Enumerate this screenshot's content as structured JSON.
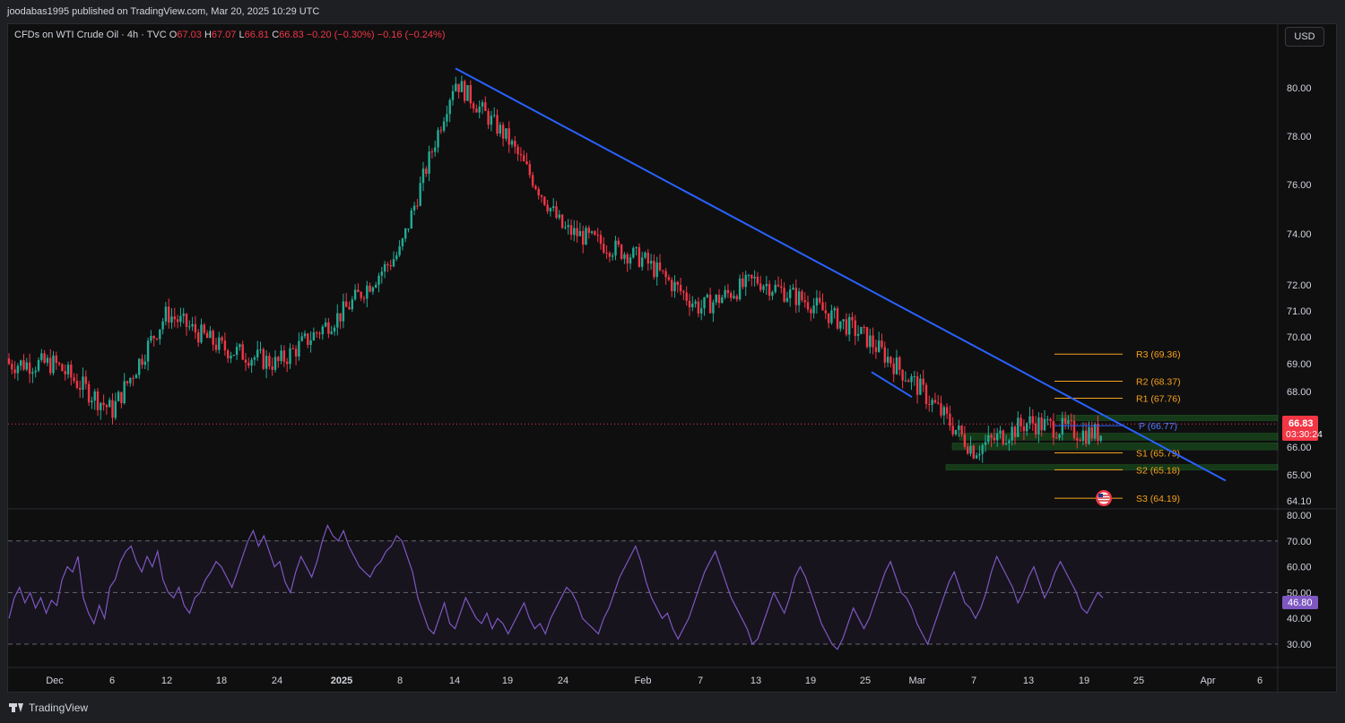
{
  "header": {
    "published": "joodabas1995 published on TradingView.com, Mar 20, 2025 10:29 UTC"
  },
  "legend": {
    "symbol": "CFDs on WTI Crude Oil · 4h · TVC",
    "o_label": "O",
    "o": "67.03",
    "h_label": "H",
    "h": "67.07",
    "l_label": "L",
    "l": "66.81",
    "c_label": "C",
    "c": "66.83",
    "change": "−0.20 (−0.30%)",
    "change2": "−0.16 (−0.24%)"
  },
  "toolbar": {
    "currency": "USD"
  },
  "footer": {
    "brand": "TradingView"
  },
  "colors": {
    "up": "#22ab94",
    "down": "#f23645",
    "trendline": "#2962ff",
    "pivot_level": "#f7a21b",
    "pivot_line": "#2962ff",
    "zone": "#1b5e20",
    "rsi": "#7e57c2",
    "rsi_band": "#7e57c2"
  },
  "chart_data": [
    {
      "type": "candlestick",
      "title": "",
      "ylabel": "",
      "ylim": [
        63.7,
        80.8
      ],
      "x_ticks": [
        "Dec",
        "6",
        "12",
        "18",
        "24",
        "2025",
        "8",
        "14",
        "19",
        "24",
        "Feb",
        "7",
        "13",
        "19",
        "25",
        "Mar",
        "7",
        "13",
        "19",
        "25",
        "Apr",
        "6"
      ],
      "y_ticks": [
        "80.00",
        "78.00",
        "76.00",
        "74.00",
        "72.00",
        "71.00",
        "70.00",
        "69.00",
        "68.00",
        "66.00",
        "65.00",
        "64.10"
      ],
      "current_price": "66.83",
      "countdown": "03:30:24",
      "close_path": [
        [
          "Dec",
          69.0
        ],
        [
          "6",
          67.3
        ],
        [
          "12",
          70.9
        ],
        [
          "18",
          69.6
        ],
        [
          "24",
          69.0
        ],
        [
          "2025",
          70.9
        ],
        [
          "8",
          73.3
        ],
        [
          "14",
          80.3
        ],
        [
          "19",
          77.9
        ],
        [
          "24",
          74.2
        ],
        [
          "Feb",
          73.0
        ],
        [
          "7",
          71.1
        ],
        [
          "13",
          72.2
        ],
        [
          "19",
          71.3
        ],
        [
          "25",
          70.0
        ],
        [
          "Mar",
          68.2
        ],
        [
          "7",
          65.9
        ],
        [
          "13",
          66.9
        ],
        [
          "19",
          66.5
        ]
      ],
      "pivots": [
        {
          "label": "R3 (69.36)",
          "value": 69.36
        },
        {
          "label": "R2 (68.37)",
          "value": 68.37
        },
        {
          "label": "R1 (67.76)",
          "value": 67.76
        },
        {
          "label": "P (66.77)",
          "value": 66.77
        },
        {
          "label": "S1 (65.79)",
          "value": 65.79
        },
        {
          "label": "S2 (65.18)",
          "value": 65.18
        },
        {
          "label": "S3 (64.19)",
          "value": 64.19
        }
      ],
      "zones": [
        {
          "low": 66.95,
          "high": 67.15
        },
        {
          "low": 66.25,
          "high": 66.5
        },
        {
          "low": 65.9,
          "high": 66.15
        },
        {
          "low": 65.17,
          "high": 65.37
        }
      ],
      "trendlines": [
        {
          "from": [
            "14",
            80.8
          ],
          "to": [
            "Apr",
            64.8
          ]
        },
        {
          "from": [
            "25",
            68.7
          ],
          "to": [
            "Mar",
            67.8
          ]
        }
      ]
    },
    {
      "type": "line",
      "title": "",
      "ylabel": "",
      "ylim": [
        25,
        81
      ],
      "y_ticks": [
        "80.00",
        "70.00",
        "60.00",
        "50.00",
        "40.00",
        "30.00"
      ],
      "band": [
        30,
        70
      ],
      "current_value": "46.80",
      "series": [
        {
          "values": [
            40,
            48,
            52,
            46,
            50,
            44,
            48,
            42,
            47,
            45,
            55,
            60,
            58,
            64,
            48,
            42,
            38,
            45,
            40,
            52,
            55,
            62,
            66,
            68,
            62,
            58,
            64,
            60,
            66,
            55,
            50,
            48,
            52,
            45,
            42,
            48,
            50,
            55,
            58,
            62,
            60,
            56,
            52,
            58,
            64,
            70,
            74,
            68,
            72,
            66,
            60,
            62,
            54,
            50,
            58,
            64,
            60,
            56,
            62,
            70,
            76,
            72,
            70,
            74,
            68,
            64,
            60,
            58,
            56,
            60,
            62,
            66,
            68,
            72,
            70,
            64,
            58,
            48,
            42,
            36,
            34,
            40,
            46,
            38,
            36,
            42,
            48,
            44,
            40,
            38,
            42,
            36,
            40,
            38,
            34,
            38,
            42,
            46,
            40,
            36,
            38,
            34,
            40,
            44,
            48,
            52,
            50,
            46,
            40,
            38,
            36,
            34,
            40,
            44,
            50,
            56,
            60,
            64,
            68,
            62,
            54,
            48,
            44,
            40,
            42,
            36,
            32,
            36,
            40,
            46,
            52,
            58,
            62,
            66,
            60,
            54,
            48,
            44,
            40,
            36,
            30,
            32,
            38,
            44,
            50,
            46,
            42,
            48,
            56,
            60,
            56,
            50,
            44,
            38,
            34,
            30,
            28,
            32,
            38,
            44,
            40,
            36,
            40,
            46,
            52,
            58,
            62,
            56,
            50,
            48,
            44,
            38,
            34,
            30,
            36,
            42,
            48,
            54,
            58,
            52,
            46,
            44,
            40,
            44,
            50,
            58,
            64,
            60,
            56,
            52,
            46,
            50,
            56,
            60,
            54,
            48,
            52,
            58,
            62,
            58,
            54,
            50,
            44,
            42,
            46,
            50,
            48
          ]
        }
      ]
    }
  ]
}
